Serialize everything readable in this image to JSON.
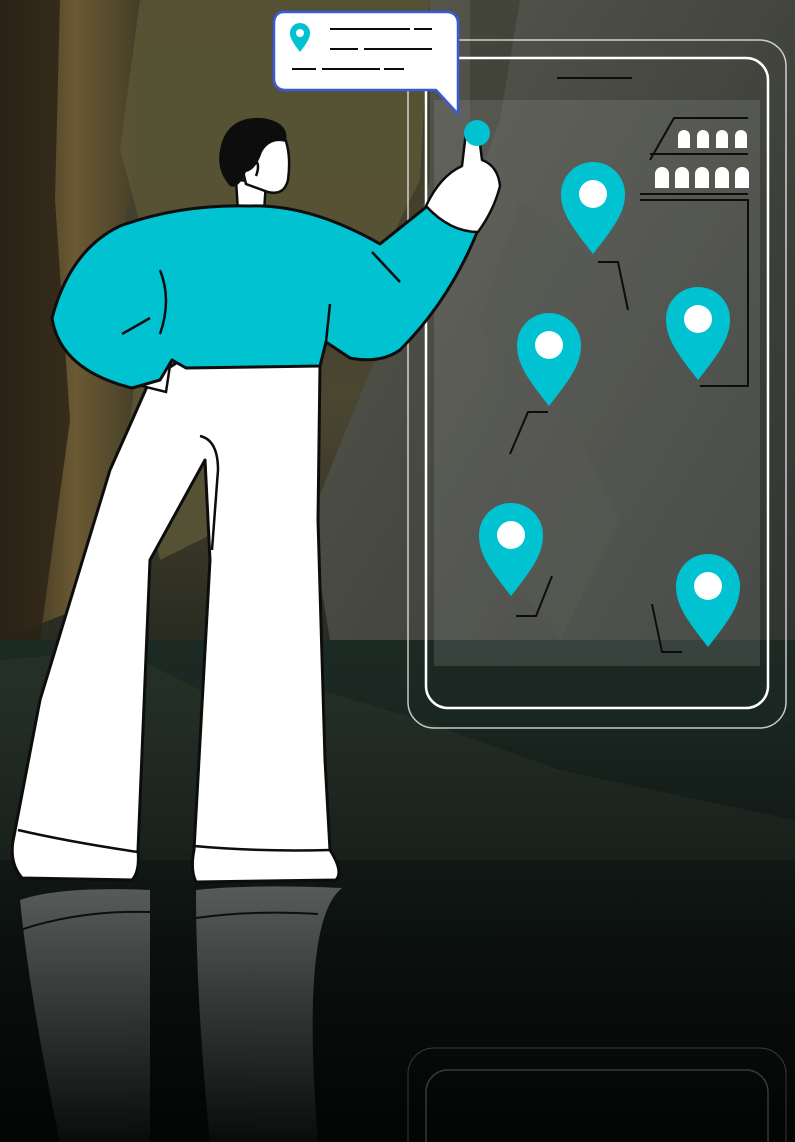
{
  "colors": {
    "accent": "#00c2d1",
    "pin_center": "#ffffff",
    "outline": "#0d0d0d",
    "bubble_border": "#3a5bd9",
    "phone_outline": "#ffffff",
    "pants": "#ffffff",
    "hair": "#0d0d0d"
  },
  "map_pins": [
    {
      "icon": "location-pin-icon"
    },
    {
      "icon": "location-pin-icon"
    },
    {
      "icon": "location-pin-icon"
    },
    {
      "icon": "location-pin-icon"
    },
    {
      "icon": "location-pin-icon"
    }
  ],
  "speech_bubble": {
    "icon": "location-pin-icon",
    "text": ""
  },
  "building_icon": "colosseum-icon"
}
